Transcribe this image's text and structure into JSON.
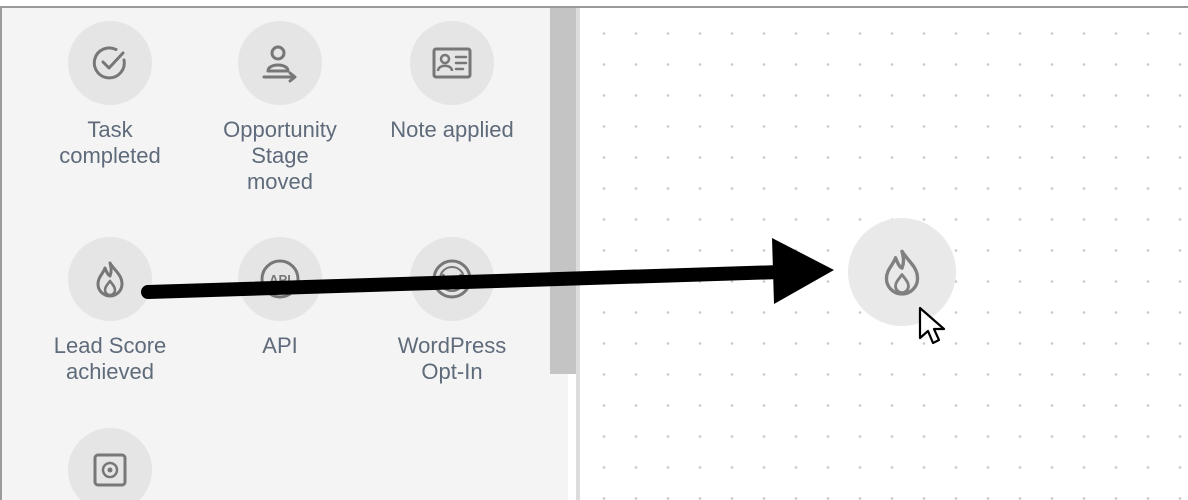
{
  "colors": {
    "panel_bg": "#f4f4f4",
    "icon_circle": "#e5e5e5",
    "icon_stroke": "#777777",
    "label_text": "#5f6b7a",
    "arrow": "#000000"
  },
  "trigger_panel": {
    "items": [
      {
        "label_lines": [
          "Task",
          "completed"
        ],
        "icon": "check-circle-icon"
      },
      {
        "label_lines": [
          "Opportunity",
          "Stage",
          "moved"
        ],
        "icon": "person-arrow-icon"
      },
      {
        "label_lines": [
          "Note applied"
        ],
        "icon": "contact-card-icon"
      },
      {
        "label_lines": [
          "Lead Score",
          "achieved"
        ],
        "icon": "flame-icon"
      },
      {
        "label_lines": [
          "API"
        ],
        "icon": "api-icon",
        "icon_text": "API"
      },
      {
        "label_lines": [
          "WordPress",
          "Opt-In"
        ],
        "icon": "wordpress-icon"
      },
      {
        "label_lines": [],
        "icon": "safe-icon"
      }
    ]
  },
  "canvas": {
    "dropped_node": {
      "icon": "flame-icon"
    }
  }
}
